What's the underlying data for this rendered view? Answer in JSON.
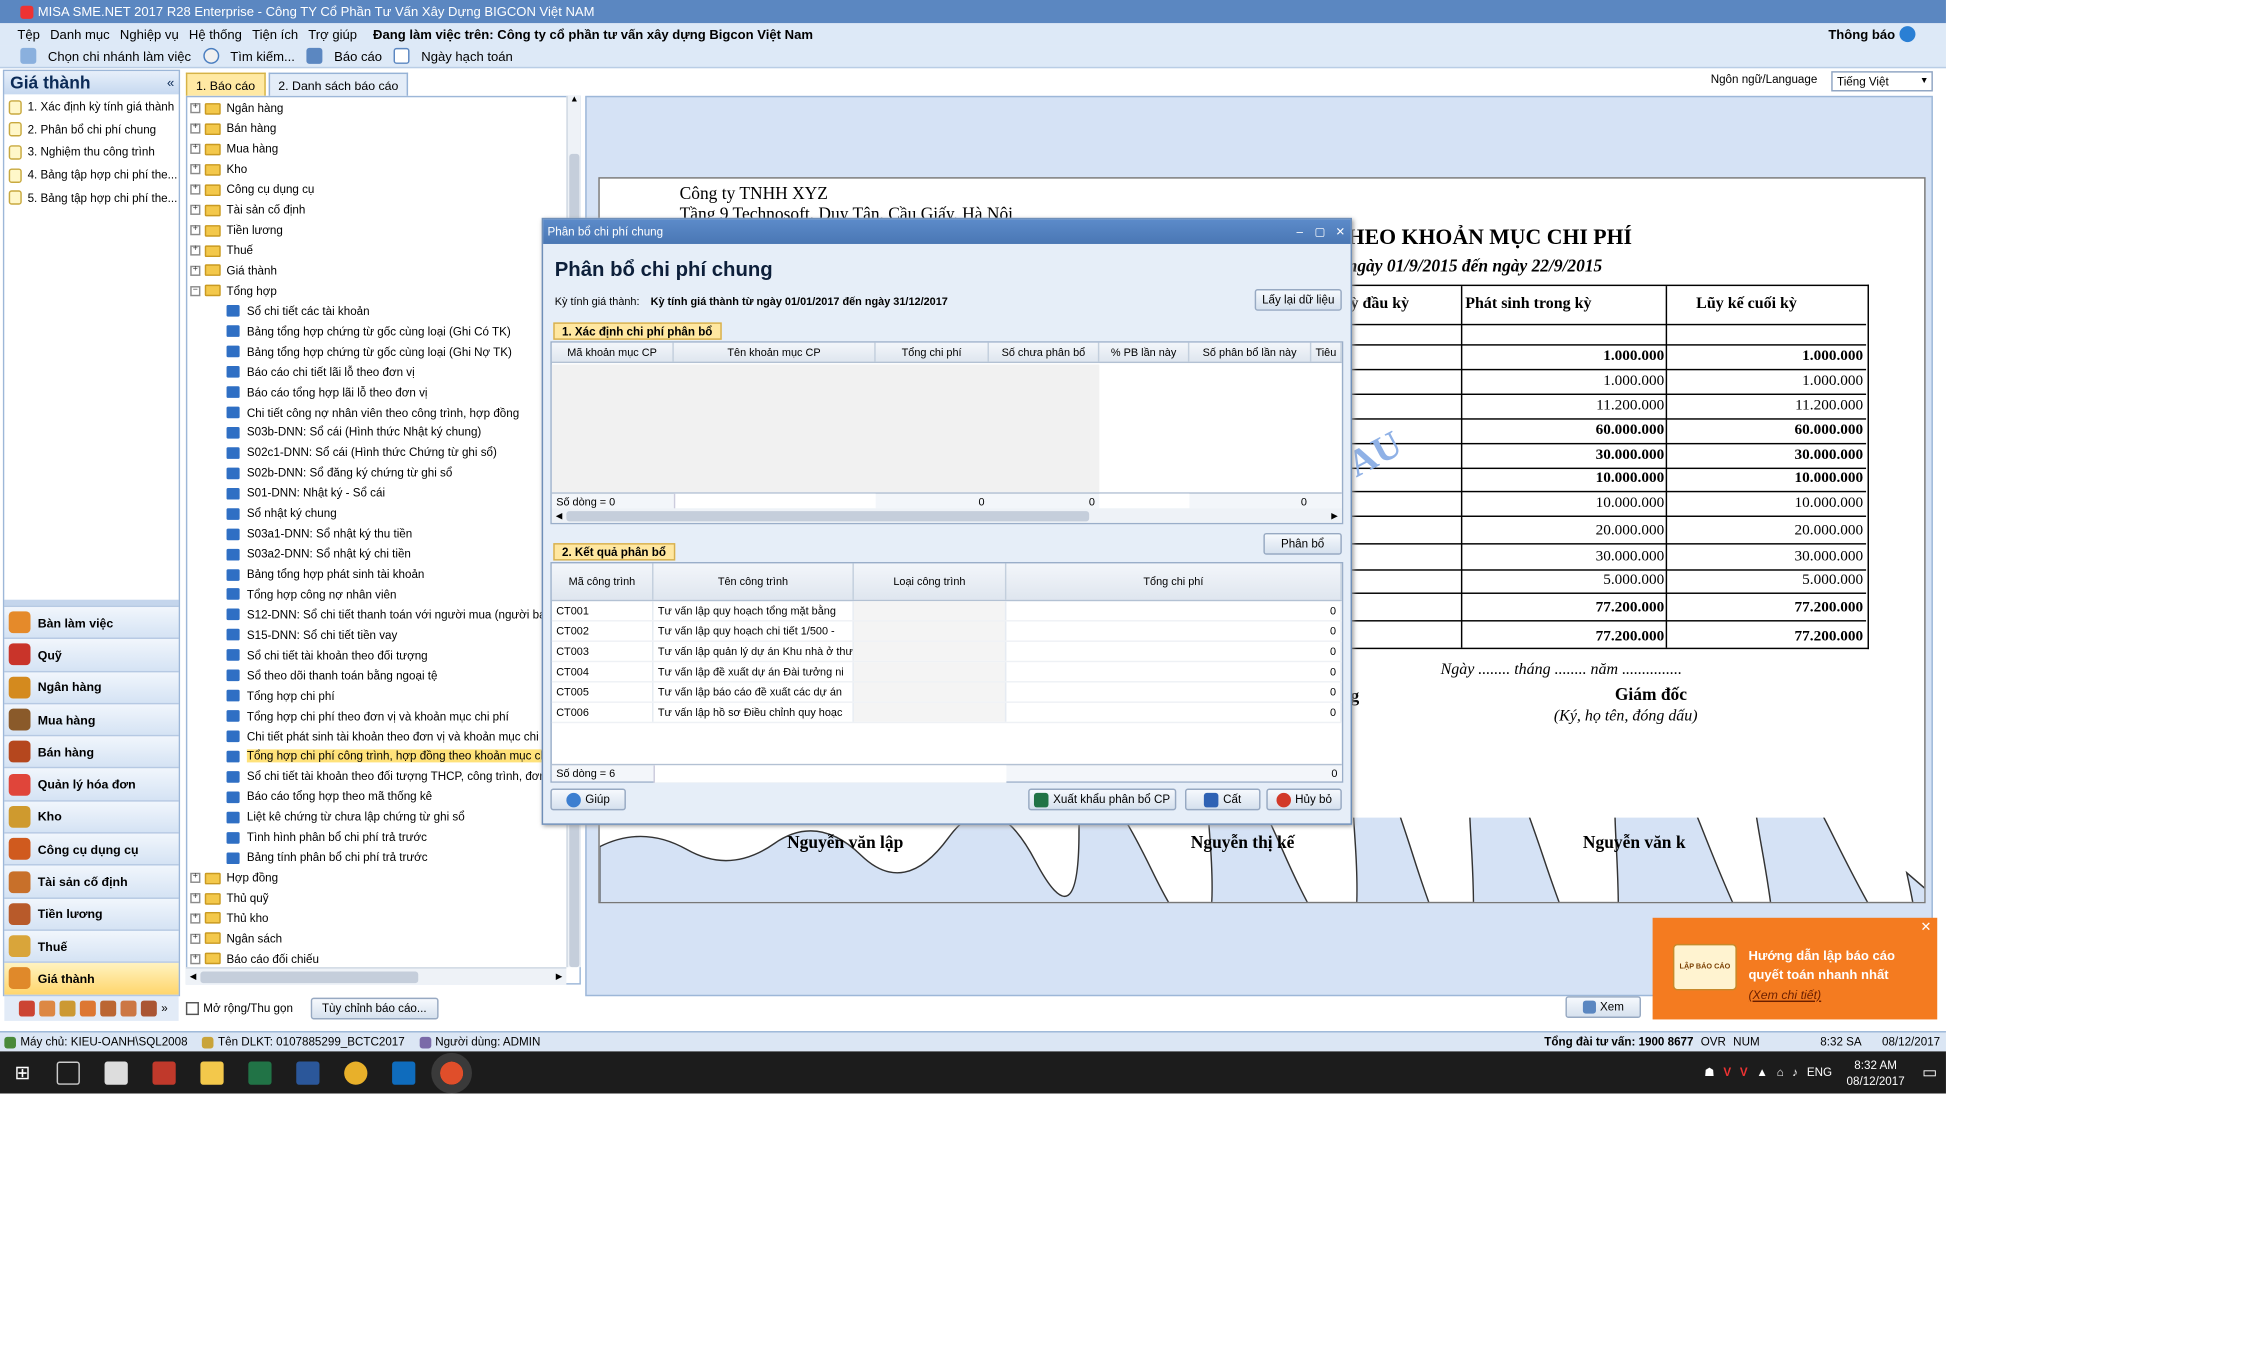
{
  "window": {
    "title": "MISA SME.NET 2017 R28 Enterprise - Công TY Cổ Phần Tư Vấn Xây Dựng BIGCON Việt NAM"
  },
  "menu": {
    "items": [
      "Tệp",
      "Danh mục",
      "Nghiệp vụ",
      "Hệ thống",
      "Tiện ích",
      "Trợ giúp"
    ],
    "working_on": "Đang làm việc trên: Công ty cổ phần tư vấn xây dựng Bigcon Việt Nam",
    "notify": "Thông báo"
  },
  "toolbar": {
    "items": [
      "Chọn chi nhánh làm việc",
      "Tìm kiếm...",
      "Báo cáo",
      "Ngày hạch toán"
    ]
  },
  "left_panel": {
    "title": "Giá thành",
    "items": [
      "1. Xác định kỳ tính giá thành",
      "2. Phân bổ chi phí chung",
      "3. Nghiệm thu công trình",
      "4. Bảng tập hợp chi phí the...",
      "5. Bảng tập hợp chi phí the..."
    ],
    "nav": [
      "Bàn làm việc",
      "Quỹ",
      "Ngân hàng",
      "Mua hàng",
      "Bán hàng",
      "Quản lý hóa đơn",
      "Kho",
      "Công cụ dụng cụ",
      "Tài sản cố định",
      "Tiền lương",
      "Thuế",
      "Giá thành"
    ]
  },
  "tabs": {
    "report": "1. Báo cáo",
    "report_list": "2. Danh sách báo cáo"
  },
  "language": {
    "label": "Ngôn ngữ/Language",
    "value": "Tiếng Việt"
  },
  "tree": {
    "top_folders": [
      "Ngân hàng",
      "Bán hàng",
      "Mua hàng",
      "Kho",
      "Công cụ dụng cụ",
      "Tài sản cố định",
      "Tiền lương",
      "Thuế",
      "Giá thành",
      "Tổng hợp"
    ],
    "reports": [
      "Sổ chi tiết các tài khoản",
      "Bảng tổng hợp chứng từ gốc cùng loại (Ghi Có TK)",
      "Bảng tổng hợp chứng từ gốc cùng loại (Ghi Nợ TK)",
      "Báo cáo chi tiết lãi lỗ theo đơn vị",
      "Báo cáo tổng hợp lãi lỗ theo đơn vị",
      "Chi tiết công nợ nhân viên theo công trình, hợp đồng",
      "S03b-DNN: Sổ cái (Hình thức Nhật ký chung)",
      "S02c1-DNN: Sổ cái (Hình thức Chứng từ ghi sổ)",
      "S02b-DNN: Sổ đăng ký chứng từ ghi sổ",
      "S01-DNN: Nhật ký - Sổ cái",
      "Sổ nhật ký chung",
      "S03a1-DNN: Sổ nhật ký thu tiền",
      "S03a2-DNN: Sổ nhật ký chi tiền",
      "Bảng tổng hợp phát sinh tài khoản",
      "Tổng hợp công nợ nhân viên",
      "S12-DNN: Sổ chi tiết thanh toán với người mua (người bán)",
      "S15-DNN: Sổ chi tiết tiền vay",
      "Sổ chi tiết tài khoản theo đối tượng",
      "Sổ theo dõi thanh toán bằng ngoại tệ",
      "Tổng hợp chi phí",
      "Tổng hợp chi phí theo đơn vị và khoản mục chi phí",
      "Chi tiết phát sinh tài khoản theo đơn vị và khoản mục chi phí",
      "Tổng hợp chi phí công trình, hợp đồng theo khoản mục chi phí",
      "Sổ chi tiết tài khoản theo đối tượng THCP, công trình, đơn hàng",
      "Báo cáo tổng hợp theo mã thống kê",
      "Liệt kê chứng từ chưa lập chứng từ ghi sổ",
      "Tình hình phân bổ chi phí trả trước",
      "Bảng tính phân bổ chi phí trả trước"
    ],
    "bottom_folders": [
      "Hợp đồng",
      "Thủ quỹ",
      "Thủ kho",
      "Ngân sách",
      "Báo cáo đối chiếu"
    ]
  },
  "tree_bottom": {
    "expand": "Mở rộng/Thu gọn",
    "customize": "Tùy chỉnh báo cáo..."
  },
  "report": {
    "company": "Công ty TNHH XYZ",
    "address": "Tầng 9 Technosoft, Duy Tân, Cầu Giấy, Hà Nội",
    "title": "HEO KHOẢN MỤC CHI PHÍ",
    "period": "ngày 01/9/2015 đến ngày 22/9/2015",
    "headers": [
      "ỳ đầu kỳ",
      "Phát sinh trong kỳ",
      "Lũy kế cuối kỳ"
    ],
    "rows": [
      [
        "1.000.000",
        "1.000.000"
      ],
      [
        "1.000.000",
        "1.000.000"
      ],
      [
        "11.200.000",
        "11.200.000"
      ],
      [
        "60.000.000",
        "60.000.000"
      ],
      [
        "30.000.000",
        "30.000.000"
      ],
      [
        "10.000.000",
        "10.000.000"
      ],
      [
        "10.000.000",
        "10.000.000"
      ],
      [
        "20.000.000",
        "20.000.000"
      ],
      [
        "30.000.000",
        "30.000.000"
      ],
      [
        "5.000.000",
        "5.000.000"
      ],
      [
        "77.200.000",
        "77.200.000"
      ],
      [
        "77.200.000",
        "77.200.000"
      ]
    ],
    "watermark": "AU",
    "date_line": "Ngày ........ tháng ........ năm ...............",
    "director": "Giám đốc",
    "sign_note": "(Ký, họ tên, đóng dấu)",
    "g": "g",
    "signers": [
      "Nguyễn văn lập",
      "Nguyễn thị kế",
      "Nguyễn văn k"
    ],
    "view_btn": "Xem"
  },
  "dialog": {
    "title": "Phân bổ chi phí chung",
    "heading": "Phân bổ chi phí chung",
    "period_label": "Kỳ tính giá thành:",
    "period_value": "Kỳ tính giá thành từ ngày 01/01/2017 đến ngày 31/12/2017",
    "reload": "Lấy lại dữ liệu",
    "section1": "1. Xác định chi phí phân bổ",
    "grid1_headers": [
      "Mã khoản mục CP",
      "Tên khoản mục CP",
      "Tổng chi phí",
      "Số chưa phân bổ",
      "% PB lần này",
      "Số phân bổ lần này",
      "Tiêu"
    ],
    "grid1_footer": {
      "count": "Số dòng = 0",
      "total": "0",
      "unalloc": "0",
      "alloc": "0"
    },
    "allocate": "Phân bổ",
    "section2": "2. Kết quả phân bổ",
    "grid2_headers": [
      "Mã công trình",
      "Tên công trình",
      "Loại công trình",
      "Tổng chi phí"
    ],
    "grid2_rows": [
      [
        "CT001",
        "Tư vấn lập quy hoạch tổng mặt bằng",
        "",
        "0"
      ],
      [
        "CT002",
        "Tư vấn lập quy hoạch chi tiết 1/500 -",
        "",
        "0"
      ],
      [
        "CT003",
        "Tư vấn lập quản lý dự án Khu nhà ở thươn",
        "",
        "0"
      ],
      [
        "CT004",
        "Tư vấn lập đề xuất dự án Đài tưởng ni",
        "",
        "0"
      ],
      [
        "CT005",
        "Tư vấn lập báo cáo đề xuất các dự án",
        "",
        "0"
      ],
      [
        "CT006",
        "Tư vấn lập hồ sơ Điều chỉnh quy hoạc",
        "",
        "0"
      ]
    ],
    "grid2_footer": {
      "count": "Số dòng = 6",
      "total": "0"
    },
    "help": "Giúp",
    "export": "Xuất khẩu phân bổ CP",
    "save": "Cất",
    "cancel": "Hủy bỏ"
  },
  "popup": {
    "line1": "Hướng dẫn lập báo cáo",
    "line2": "quyết toán nhanh nhất",
    "link": "(Xem chi tiết)",
    "badge": "LẬP BÁO CÁO"
  },
  "status": {
    "machine": "Máy chủ: KIEU-OANH\\SQL2008",
    "db": "Tên DLKT: 0107885299_BCTC2017",
    "user": "Người dùng: ADMIN",
    "hotline": "Tổng đài tư vấn: 1900 8677",
    "ovr": "OVR",
    "num": "NUM",
    "time": "8:32 SA",
    "date": "08/12/2017"
  },
  "taskbar": {
    "time": "8:32 AM",
    "date": "08/12/2017",
    "lang": "ENG"
  },
  "colors": {
    "title_blue": "#5b87c1",
    "highlight": "#ffe27a",
    "orange": "#f47b20"
  }
}
